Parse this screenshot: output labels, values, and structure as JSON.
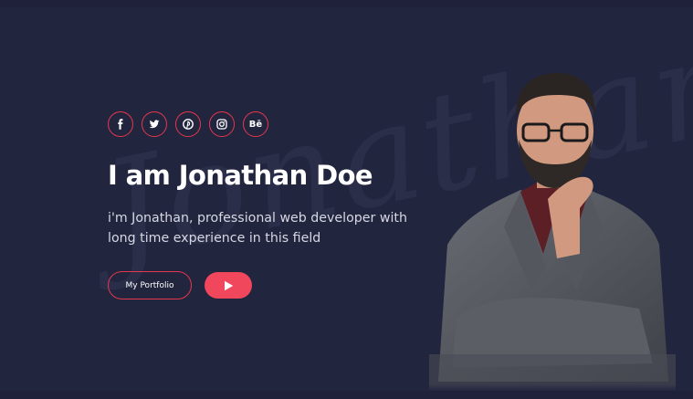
{
  "watermark_text": "Jonathan D",
  "socials": [
    {
      "name": "facebook",
      "icon": "facebook-icon"
    },
    {
      "name": "twitter",
      "icon": "twitter-icon"
    },
    {
      "name": "pinterest",
      "icon": "pinterest-icon"
    },
    {
      "name": "instagram",
      "icon": "instagram-icon"
    },
    {
      "name": "behance",
      "icon": "behance-icon",
      "glyph": "Bē"
    }
  ],
  "hero": {
    "title": "I am Jonathan Doe",
    "subtitle": "i'm Jonathan, professional web developer with long time experience in this field",
    "portfolio_label": "My Portfolio"
  },
  "colors": {
    "background": "#22253e",
    "accent": "#f0475c",
    "text": "#ffffff"
  }
}
